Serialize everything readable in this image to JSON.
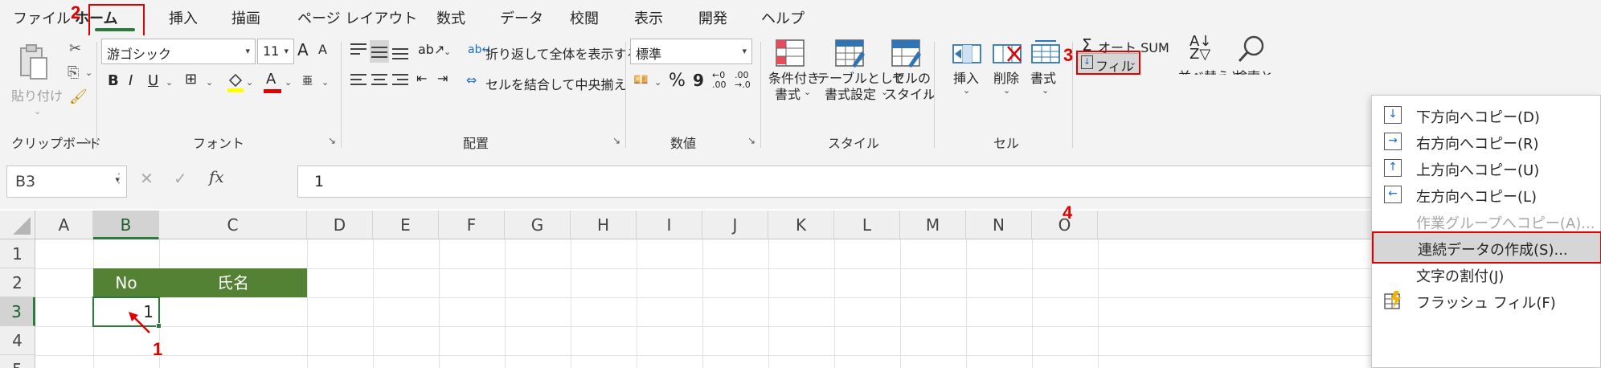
{
  "menu": {
    "items": [
      "ファイル",
      "ホーム",
      "挿入",
      "描画",
      "ページ レイアウト",
      "数式",
      "データ",
      "校閲",
      "表示",
      "開発",
      "ヘルプ"
    ]
  },
  "callouts": {
    "one": "1",
    "two": "2",
    "three": "3",
    "four": "4"
  },
  "ribbon": {
    "clipboard": {
      "paste": "貼り付け",
      "label": "クリップボード"
    },
    "font": {
      "name": "游ゴシック",
      "size": "11",
      "grow": "A",
      "shrink": "A",
      "bold": "B",
      "italic": "I",
      "underline": "U",
      "font_color": "A",
      "phonetic": "亜",
      "label": "フォント"
    },
    "alignment": {
      "wrap": "折り返して全体を表示する",
      "merge": "セルを結合して中央揃え",
      "label": "配置"
    },
    "number": {
      "format": "標準",
      "percent": "%",
      "comma": "9",
      "inc_decimal": ".00",
      "dec_decimal": ".00",
      "label": "数値"
    },
    "styles": {
      "conditional_line1": "条件付き",
      "conditional_line2": "書式",
      "table_line1": "テーブルとして",
      "table_line2": "書式設定",
      "cell_line1": "セルの",
      "cell_line2": "スタイル",
      "label": "スタイル"
    },
    "cells": {
      "insert": "挿入",
      "delete": "削除",
      "format": "書式",
      "label": "セル"
    },
    "editing": {
      "autosum": "オート SUM",
      "fill": "フィル",
      "sort_partial": "並べ替えと",
      "find_partial": "検索と"
    }
  },
  "formula_bar": {
    "name_box": "B3",
    "fx": "fx",
    "value": "1"
  },
  "sheet": {
    "columns": [
      "A",
      "B",
      "C",
      "D",
      "E",
      "F",
      "G",
      "H",
      "I",
      "J",
      "K",
      "L",
      "M",
      "N",
      "O"
    ],
    "rows": [
      "1",
      "2",
      "3",
      "4",
      "5"
    ],
    "header_no": "No",
    "header_name": "氏名",
    "b3_value": "1",
    "selected_cell": "B3",
    "header_fill": "#548235"
  },
  "fill_menu": {
    "items": [
      {
        "label": "下方向へコピー(D)",
        "icon": "arrow-down",
        "enabled": true
      },
      {
        "label": "右方向へコピー(R)",
        "icon": "arrow-right",
        "enabled": true
      },
      {
        "label": "上方向へコピー(U)",
        "icon": "arrow-up",
        "enabled": true
      },
      {
        "label": "左方向へコピー(L)",
        "icon": "arrow-left",
        "enabled": true
      },
      {
        "label": "作業グループへコピー(A)...",
        "icon": "",
        "enabled": false
      },
      {
        "label": "連続データの作成(S)...",
        "icon": "",
        "enabled": true,
        "highlighted": true
      },
      {
        "label": "文字の割付(J)",
        "icon": "",
        "enabled": true
      },
      {
        "label": "フラッシュ フィル(F)",
        "icon": "flash-fill",
        "enabled": true
      }
    ]
  },
  "colors": {
    "accent_green": "#2b7a3c",
    "callout_red": "#e00000"
  }
}
